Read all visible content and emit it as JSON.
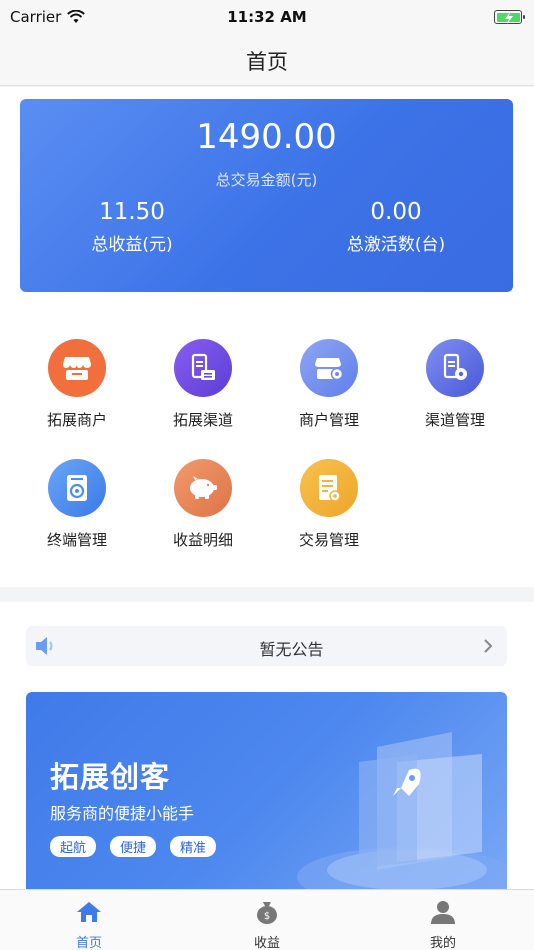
{
  "status": {
    "carrier": "Carrier",
    "time": "11:32 AM"
  },
  "nav": {
    "title": "首页"
  },
  "summary": {
    "total_amount": "1490.00",
    "total_amount_label": "总交易金额(元)",
    "income_value": "11.50",
    "income_label": "总收益(元)",
    "activations_value": "0.00",
    "activations_label": "总激活数(台)"
  },
  "menu": [
    {
      "label": "拓展商户",
      "icon": "store-icon",
      "color": "#f06f3d"
    },
    {
      "label": "拓展渠道",
      "icon": "channel-device-icon",
      "color": "#7a4fe4"
    },
    {
      "label": "商户管理",
      "icon": "store-settings-icon",
      "color": "#6d8df0"
    },
    {
      "label": "渠道管理",
      "icon": "channel-settings-icon",
      "color": "#5b6fe6"
    },
    {
      "label": "终端管理",
      "icon": "terminal-settings-icon",
      "color": "#4d8ff0"
    },
    {
      "label": "收益明细",
      "icon": "piggy-bank-icon",
      "color": "#e8855a"
    },
    {
      "label": "交易管理",
      "icon": "document-settings-icon",
      "color": "#f3b43a"
    }
  ],
  "notice": {
    "text": "暂无公告"
  },
  "banner": {
    "title": "拓展创客",
    "subtitle": "服务商的便捷小能手",
    "tags": [
      "起航",
      "便捷",
      "精准"
    ]
  },
  "tabs": [
    {
      "label": "首页",
      "icon": "home-icon",
      "active": true
    },
    {
      "label": "收益",
      "icon": "money-bag-icon",
      "active": false
    },
    {
      "label": "我的",
      "icon": "user-icon",
      "active": false
    }
  ],
  "colors": {
    "accent": "#3f7ae9"
  }
}
